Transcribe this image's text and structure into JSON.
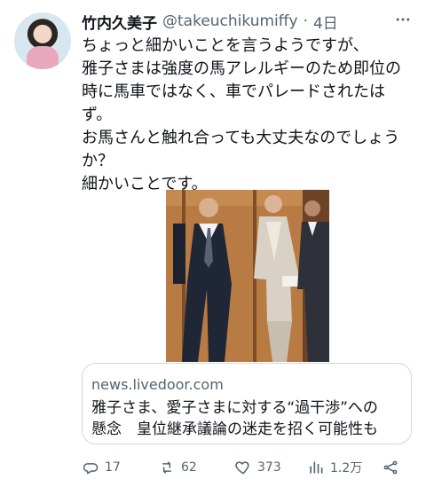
{
  "author": {
    "display_name": "竹内久美子",
    "handle": "@takeuchikumiffy",
    "separator": "·",
    "time": "4日"
  },
  "tweet": {
    "lines": [
      "ちょっと細かいことを言うようですが、",
      "雅子さまは強度の馬アレルギーのため即位の",
      "時に馬車ではなく、車でパレードされたは",
      "ず。",
      "お馬さんと触れ合っても大丈夫なのでしょう",
      "か？",
      "細かいことです。"
    ]
  },
  "link_card": {
    "domain": "news.livedoor.com",
    "title_lines": [
      "雅子さま、愛子さまに対する“過干渉”への",
      "懸念　皇位継承議論の迷走を招く可能性も"
    ]
  },
  "actions": {
    "replies": "17",
    "retweets": "62",
    "likes": "373",
    "views": "1.2万"
  },
  "icons": {
    "more": "more-icon",
    "reply": "reply-icon",
    "retweet": "retweet-icon",
    "like": "like-icon",
    "views": "views-icon",
    "share": "share-icon"
  },
  "colors": {
    "text": "#0f1419",
    "secondary": "#536471",
    "border": "#cfd9de",
    "background": "#ffffff"
  }
}
